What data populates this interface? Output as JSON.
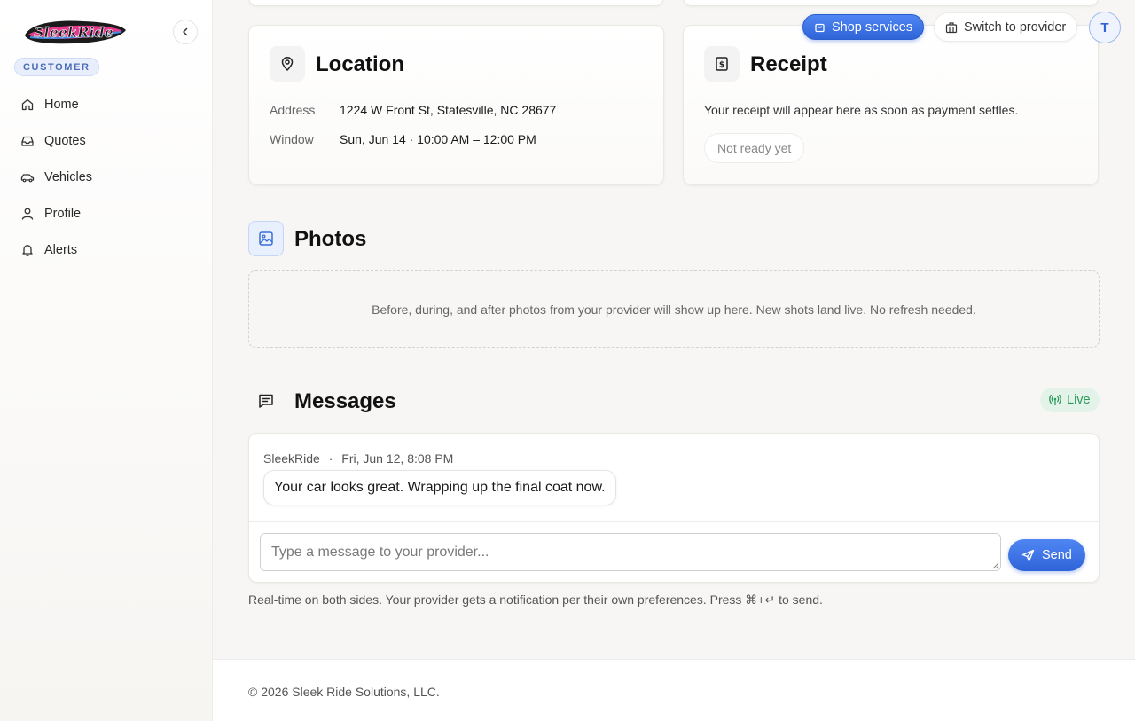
{
  "app": {
    "brand": "SleekRide",
    "role": "CUSTOMER"
  },
  "sidebar": {
    "items": [
      {
        "label": "Home",
        "icon": "home-icon"
      },
      {
        "label": "Quotes",
        "icon": "inbox-icon"
      },
      {
        "label": "Vehicles",
        "icon": "car-icon"
      },
      {
        "label": "Profile",
        "icon": "user-icon"
      },
      {
        "label": "Alerts",
        "icon": "bell-icon"
      }
    ]
  },
  "header": {
    "shop_label": "Shop services",
    "switch_label": "Switch to provider",
    "avatar_initial": "T"
  },
  "location": {
    "title": "Location",
    "address_label": "Address",
    "address_value": "1224 W Front St, Statesville, NC 28677",
    "window_label": "Window",
    "window_value": "Sun, Jun 14 · 10:00 AM – 12:00 PM"
  },
  "receipt": {
    "title": "Receipt",
    "description": "Your receipt will appear here as soon as payment settles.",
    "status": "Not ready yet"
  },
  "photos": {
    "title": "Photos",
    "empty_text": "Before, during, and after photos from your provider will show up here. New shots land live. No refresh needed."
  },
  "messages": {
    "title": "Messages",
    "live_label": "Live",
    "items": [
      {
        "sender": "SleekRide",
        "separator": "·",
        "time": "Fri, Jun 12, 8:08 PM",
        "text": "Your car looks great. Wrapping up the final coat now."
      }
    ],
    "input_placeholder": "Type a message to your provider...",
    "send_label": "Send",
    "hint": "Real-time on both sides. Your provider gets a notification per their own preferences. Press ⌘+↵ to send."
  },
  "footer": {
    "copyright": "© 2026 Sleek Ride Solutions, LLC."
  },
  "colors": {
    "accent": "#2f64d8",
    "live": "#2e9a5c",
    "role_badge": "#4c6db6"
  }
}
